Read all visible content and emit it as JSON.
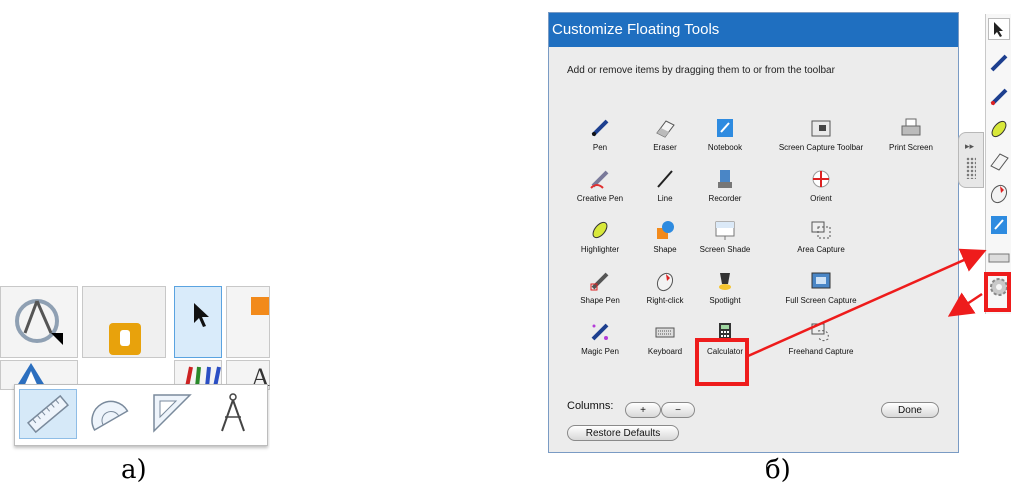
{
  "panel_a": {
    "caption": "а)",
    "geometry_tools": [
      "ruler-icon",
      "protractor-icon",
      "set-square-icon",
      "compass-icon"
    ]
  },
  "panel_b": {
    "caption": "б)"
  },
  "dialog": {
    "title": "Customize Floating Tools",
    "instruction": "Add or remove items by dragging them to or from the toolbar",
    "tools": [
      {
        "label": "Pen",
        "icon": "pen-icon"
      },
      {
        "label": "Eraser",
        "icon": "eraser-icon"
      },
      {
        "label": "Notebook",
        "icon": "notebook-icon"
      },
      {
        "label": "Screen Capture Toolbar",
        "icon": "screen-capture-toolbar-icon"
      },
      {
        "label": "Print Screen",
        "icon": "printer-icon"
      },
      {
        "label": "Creative Pen",
        "icon": "creative-pen-icon"
      },
      {
        "label": "Line",
        "icon": "line-icon"
      },
      {
        "label": "Recorder",
        "icon": "recorder-icon"
      },
      {
        "label": "Orient",
        "icon": "orient-icon"
      },
      {
        "label": "Highlighter",
        "icon": "highlighter-icon"
      },
      {
        "label": "Shape",
        "icon": "shape-icon"
      },
      {
        "label": "Screen Shade",
        "icon": "screen-shade-icon"
      },
      {
        "label": "Area Capture",
        "icon": "area-capture-icon"
      },
      {
        "label": "Shape Pen",
        "icon": "shape-pen-icon"
      },
      {
        "label": "Right-click",
        "icon": "right-click-icon"
      },
      {
        "label": "Spotlight",
        "icon": "spotlight-icon"
      },
      {
        "label": "Full Screen Capture",
        "icon": "full-screen-capture-icon"
      },
      {
        "label": "Magic Pen",
        "icon": "magic-pen-icon"
      },
      {
        "label": "Keyboard",
        "icon": "keyboard-icon"
      },
      {
        "label": "Calculator",
        "icon": "calculator-icon"
      },
      {
        "label": "Freehand Capture",
        "icon": "freehand-capture-icon"
      }
    ],
    "columns_label": "Columns:",
    "plus_label": "+",
    "minus_label": "−",
    "done_label": "Done",
    "restore_label": "Restore Defaults"
  },
  "floating_toolbar": {
    "icons": [
      "select-arrow-icon",
      "pen-icon",
      "pen-red-icon",
      "highlighter-icon",
      "eraser-icon",
      "right-click-icon",
      "notebook-icon",
      "keyboard-icon",
      "gear-icon"
    ]
  },
  "colors": {
    "title_bar": "#1f6fc0",
    "highlight": "#ee1c1c"
  }
}
